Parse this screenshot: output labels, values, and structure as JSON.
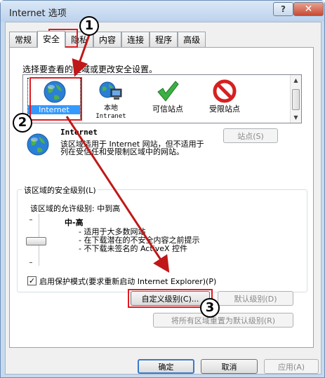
{
  "window": {
    "title": "Internet 选项",
    "help": "?",
    "close": "✕"
  },
  "tabs": [
    "常规",
    "安全",
    "隐私",
    "内容",
    "连接",
    "程序",
    "高级"
  ],
  "security": {
    "instruction": "选择要查看的区域或更改安全设置。",
    "zones": [
      {
        "label": "Internet",
        "icon": "globe-icon"
      },
      {
        "label": "本地\nIntranet",
        "icon": "local-network-icon"
      },
      {
        "label": "可信站点",
        "icon": "green-check-icon"
      },
      {
        "label": "受限站点",
        "icon": "no-entry-icon"
      }
    ],
    "sites_button": "站点(S)",
    "zone_name": "Internet",
    "zone_description": "该区域适用于 Internet 网站，但不适用于列在受信任和受限制区域中的网站。",
    "level_group_label": "该区域的安全级别(L)",
    "allowed_levels": "该区域的允许级别: 中到高",
    "level_name": "中-高",
    "bullets": [
      "- 适用于大多数网站",
      "- 在下载潜在的不安全内容之前提示",
      "- 不下载未签名的 ActiveX 控件"
    ],
    "protected_mode": "启用保护模式(要求重新启动 Internet Explorer)(P)",
    "protected_mode_checked": "✓",
    "custom_level": "自定义级别(C)...",
    "default_level": "默认级别(D)",
    "reset_all": "将所有区域重置为默认级别(R)"
  },
  "footer": {
    "ok": "确定",
    "cancel": "取消",
    "apply": "应用(A)"
  },
  "annotations": [
    "1",
    "2",
    "3"
  ],
  "colors": {
    "highlight": "#e01b22",
    "selection": "#3399ff"
  }
}
